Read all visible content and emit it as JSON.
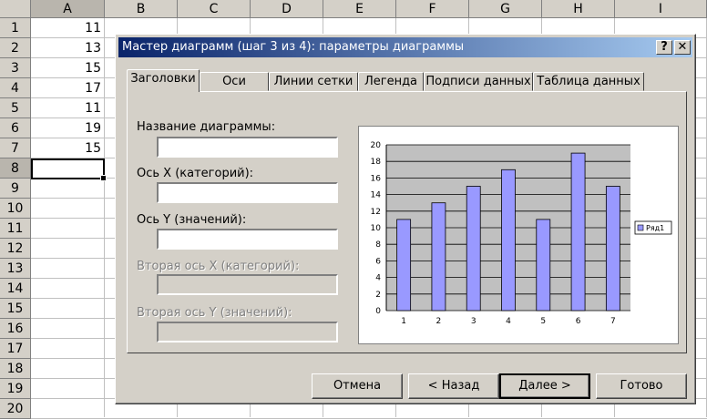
{
  "sheet": {
    "columns": [
      "A",
      "B",
      "C",
      "D",
      "E",
      "F",
      "G",
      "H",
      "I"
    ],
    "rows": [
      "1",
      "2",
      "3",
      "4",
      "5",
      "6",
      "7",
      "8",
      "9",
      "10",
      "11",
      "12",
      "13",
      "14",
      "15",
      "16",
      "17",
      "18",
      "19",
      "20"
    ],
    "values": [
      "11",
      "13",
      "15",
      "17",
      "11",
      "19",
      "15"
    ]
  },
  "dialog": {
    "title": "Мастер диаграмм (шаг 3 из 4): параметры диаграммы",
    "help_btn": "?",
    "close_btn": "✕",
    "tabs": [
      "Заголовки",
      "Оси",
      "Линии сетки",
      "Легенда",
      "Подписи данных",
      "Таблица данных"
    ],
    "fields": {
      "chart_title": "Название диаграммы:",
      "x_axis": "Ось X (категорий):",
      "y_axis": "Ось Y (значений):",
      "x2_axis": "Вторая ось X (категорий):",
      "y2_axis": "Вторая ось Y (значений):"
    },
    "buttons": {
      "cancel": "Отмена",
      "back": "< Назад",
      "next": "Далее >",
      "finish": "Готово"
    }
  },
  "chart_data": {
    "type": "bar",
    "categories": [
      "1",
      "2",
      "3",
      "4",
      "5",
      "6",
      "7"
    ],
    "series": [
      {
        "name": "Ряд1",
        "values": [
          11,
          13,
          15,
          17,
          11,
          19,
          15
        ]
      }
    ],
    "ylim": [
      0,
      20
    ],
    "yticks": [
      "0",
      "2",
      "4",
      "6",
      "8",
      "10",
      "12",
      "14",
      "16",
      "18",
      "20"
    ],
    "title": "",
    "xlabel": "",
    "ylabel": "",
    "legend": "right",
    "grid": true,
    "colors": {
      "bar": "#9999ff",
      "plot_bg": "#c0c0c0"
    }
  }
}
